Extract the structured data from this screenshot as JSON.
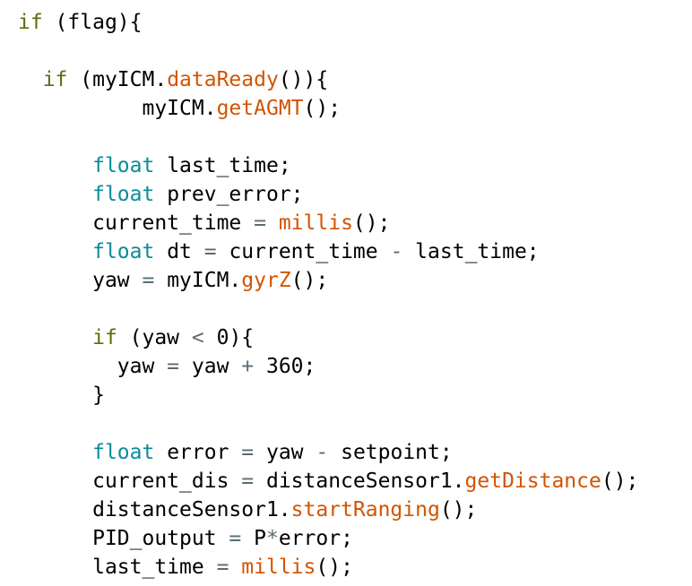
{
  "theme": {
    "keyword_color": "#5a6e0e",
    "type_color": "#0b8b9a",
    "function_color": "#d35400",
    "operator_color": "#5b6b73",
    "text_color": "#000000",
    "background": "#ffffff"
  },
  "code": {
    "lines": [
      {
        "indent": 0,
        "tokens": [
          {
            "t": "if",
            "k": "kw"
          },
          {
            "t": " (flag){",
            "k": "plain"
          }
        ]
      },
      {
        "indent": 0,
        "tokens": []
      },
      {
        "indent": 1,
        "tokens": [
          {
            "t": "if",
            "k": "kw"
          },
          {
            "t": " (myICM.",
            "k": "plain"
          },
          {
            "t": "dataReady",
            "k": "fn"
          },
          {
            "t": "()){",
            "k": "plain"
          }
        ]
      },
      {
        "indent": 5,
        "tokens": [
          {
            "t": "myICM.",
            "k": "plain"
          },
          {
            "t": "getAGMT",
            "k": "fn"
          },
          {
            "t": "();",
            "k": "plain"
          }
        ]
      },
      {
        "indent": 0,
        "tokens": []
      },
      {
        "indent": 3,
        "tokens": [
          {
            "t": "float",
            "k": "type"
          },
          {
            "t": " last_time;",
            "k": "plain"
          }
        ]
      },
      {
        "indent": 3,
        "tokens": [
          {
            "t": "float",
            "k": "type"
          },
          {
            "t": " prev_error;",
            "k": "plain"
          }
        ]
      },
      {
        "indent": 3,
        "tokens": [
          {
            "t": "current_time ",
            "k": "plain"
          },
          {
            "t": "=",
            "k": "op"
          },
          {
            "t": " ",
            "k": "plain"
          },
          {
            "t": "millis",
            "k": "fn"
          },
          {
            "t": "();",
            "k": "plain"
          }
        ]
      },
      {
        "indent": 3,
        "tokens": [
          {
            "t": "float",
            "k": "type"
          },
          {
            "t": " dt ",
            "k": "plain"
          },
          {
            "t": "=",
            "k": "op"
          },
          {
            "t": " current_time ",
            "k": "plain"
          },
          {
            "t": "-",
            "k": "op"
          },
          {
            "t": " last_time;",
            "k": "plain"
          }
        ]
      },
      {
        "indent": 3,
        "tokens": [
          {
            "t": "yaw ",
            "k": "plain"
          },
          {
            "t": "=",
            "k": "op"
          },
          {
            "t": " myICM.",
            "k": "plain"
          },
          {
            "t": "gyrZ",
            "k": "fn"
          },
          {
            "t": "();",
            "k": "plain"
          }
        ]
      },
      {
        "indent": 0,
        "tokens": []
      },
      {
        "indent": 3,
        "tokens": [
          {
            "t": "if",
            "k": "kw"
          },
          {
            "t": " (yaw ",
            "k": "plain"
          },
          {
            "t": "<",
            "k": "op"
          },
          {
            "t": " 0){",
            "k": "plain"
          }
        ]
      },
      {
        "indent": 4,
        "tokens": [
          {
            "t": "yaw ",
            "k": "plain"
          },
          {
            "t": "=",
            "k": "op"
          },
          {
            "t": " yaw ",
            "k": "plain"
          },
          {
            "t": "+",
            "k": "op"
          },
          {
            "t": " 360;",
            "k": "plain"
          }
        ]
      },
      {
        "indent": 3,
        "tokens": [
          {
            "t": "}",
            "k": "plain"
          }
        ]
      },
      {
        "indent": 0,
        "tokens": []
      },
      {
        "indent": 3,
        "tokens": [
          {
            "t": "float",
            "k": "type"
          },
          {
            "t": " error ",
            "k": "plain"
          },
          {
            "t": "=",
            "k": "op"
          },
          {
            "t": " yaw ",
            "k": "plain"
          },
          {
            "t": "-",
            "k": "op"
          },
          {
            "t": " setpoint;",
            "k": "plain"
          }
        ]
      },
      {
        "indent": 3,
        "tokens": [
          {
            "t": "current_dis ",
            "k": "plain"
          },
          {
            "t": "=",
            "k": "op"
          },
          {
            "t": " distanceSensor1.",
            "k": "plain"
          },
          {
            "t": "getDistance",
            "k": "fn"
          },
          {
            "t": "();",
            "k": "plain"
          }
        ]
      },
      {
        "indent": 3,
        "tokens": [
          {
            "t": "distanceSensor1.",
            "k": "plain"
          },
          {
            "t": "startRanging",
            "k": "fn"
          },
          {
            "t": "();",
            "k": "plain"
          }
        ]
      },
      {
        "indent": 3,
        "tokens": [
          {
            "t": "PID_output ",
            "k": "plain"
          },
          {
            "t": "=",
            "k": "op"
          },
          {
            "t": " P",
            "k": "plain"
          },
          {
            "t": "*",
            "k": "op"
          },
          {
            "t": "error;",
            "k": "plain"
          }
        ]
      },
      {
        "indent": 3,
        "tokens": [
          {
            "t": "last_time ",
            "k": "plain"
          },
          {
            "t": "=",
            "k": "op"
          },
          {
            "t": " ",
            "k": "plain"
          },
          {
            "t": "millis",
            "k": "fn"
          },
          {
            "t": "();",
            "k": "plain"
          }
        ]
      }
    ]
  }
}
